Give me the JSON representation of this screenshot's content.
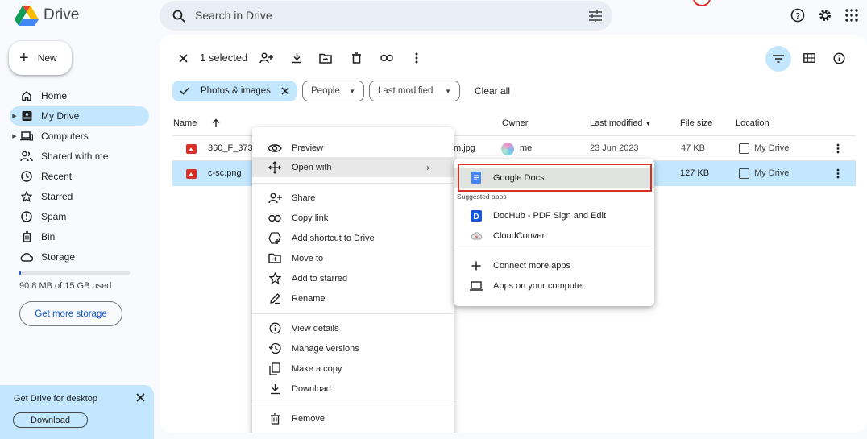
{
  "app": {
    "name": "Drive"
  },
  "search": {
    "placeholder": "Search in Drive"
  },
  "sidebar": {
    "new_label": "New",
    "items": [
      {
        "label": "Home",
        "icon": "home-icon"
      },
      {
        "label": "My Drive",
        "icon": "my-drive-icon",
        "active": true,
        "expandable": true
      },
      {
        "label": "Computers",
        "icon": "computers-icon",
        "expandable": true
      },
      {
        "label": "Shared with me",
        "icon": "shared-icon"
      },
      {
        "label": "Recent",
        "icon": "clock-icon"
      },
      {
        "label": "Starred",
        "icon": "star-icon"
      },
      {
        "label": "Spam",
        "icon": "spam-icon"
      },
      {
        "label": "Bin",
        "icon": "trash-icon"
      },
      {
        "label": "Storage",
        "icon": "cloud-icon"
      }
    ],
    "storage_used_fraction": 0.006,
    "storage_text": "90.8 MB of 15 GB used",
    "get_more_storage": "Get more storage",
    "desktop_promo": {
      "title": "Get Drive for desktop",
      "button": "Download"
    }
  },
  "toolbar": {
    "selected_text": "1 selected"
  },
  "filters": {
    "photos": "Photos & images",
    "people": "People",
    "last_modified": "Last modified",
    "clear_all": "Clear all"
  },
  "table": {
    "columns": {
      "name": "Name",
      "owner": "Owner",
      "last_modified": "Last modified",
      "file_size": "File size",
      "location": "Location"
    },
    "rows": [
      {
        "name": "360_F_373",
        "name_tail": "m.jpg",
        "owner": "me",
        "modified": "23 Jun 2023",
        "size": "47 KB",
        "location": "My Drive"
      },
      {
        "name": "c-sc.png",
        "size": "127 KB",
        "location": "My Drive",
        "selected": true
      }
    ]
  },
  "context_menu": {
    "items": [
      {
        "label": "Preview",
        "icon": "eye-icon"
      },
      {
        "label": "Open with",
        "icon": "move-arrows-icon",
        "has_submenu": true
      },
      {
        "label": "Share",
        "icon": "person-add-icon"
      },
      {
        "label": "Copy link",
        "icon": "link-icon"
      },
      {
        "label": "Add shortcut to Drive",
        "icon": "add-shortcut-icon"
      },
      {
        "label": "Move to",
        "icon": "move-folder-icon"
      },
      {
        "label": "Add to starred",
        "icon": "star-icon"
      },
      {
        "label": "Rename",
        "icon": "pencil-icon"
      },
      {
        "label": "View details",
        "icon": "info-icon"
      },
      {
        "label": "Manage versions",
        "icon": "history-icon"
      },
      {
        "label": "Make a copy",
        "icon": "copy-icon"
      },
      {
        "label": "Download",
        "icon": "download-icon"
      },
      {
        "label": "Remove",
        "icon": "trash-icon"
      }
    ]
  },
  "open_with": {
    "google_docs": "Google Docs",
    "suggested_label": "Suggested apps",
    "dochub": "DocHub - PDF Sign and Edit",
    "cloudconvert": "CloudConvert",
    "connect_more": "Connect more apps",
    "apps_on_computer": "Apps on your computer"
  },
  "colors": {
    "accent": "#c2e7ff",
    "link": "#0b57d0",
    "highlight_outline": "#d93025"
  }
}
